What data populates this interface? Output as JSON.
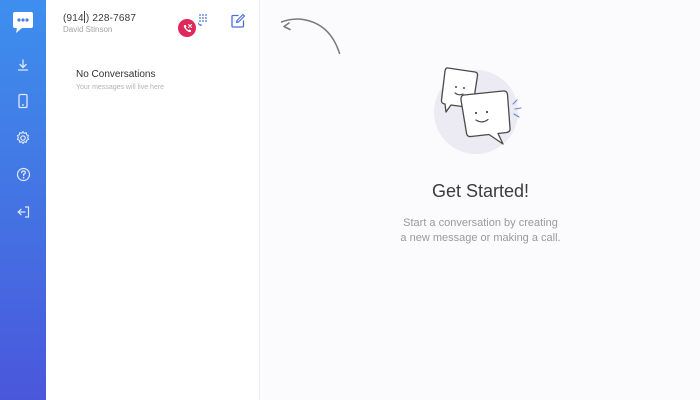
{
  "sidebar": {
    "items": [
      {
        "name": "download",
        "icon": "download-icon"
      },
      {
        "name": "device",
        "icon": "phone-device-icon"
      },
      {
        "name": "settings",
        "icon": "gear-icon"
      },
      {
        "name": "help",
        "icon": "help-icon"
      },
      {
        "name": "logout",
        "icon": "logout-icon"
      }
    ]
  },
  "account": {
    "phone_pre": "(914",
    "phone_post": ") 228-7687",
    "name": "David Stinson"
  },
  "conversations": {
    "empty_title": "No Conversations",
    "empty_subtitle": "Your messages will live here"
  },
  "main": {
    "headline": "Get Started!",
    "description_line1": "Start a conversation by creating",
    "description_line2": "a new message or making a call."
  },
  "colors": {
    "sidebar_top": "#3d8fee",
    "sidebar_bottom": "#4a57dc",
    "call_badge": "#e0285d",
    "background": "#fbfafd"
  }
}
